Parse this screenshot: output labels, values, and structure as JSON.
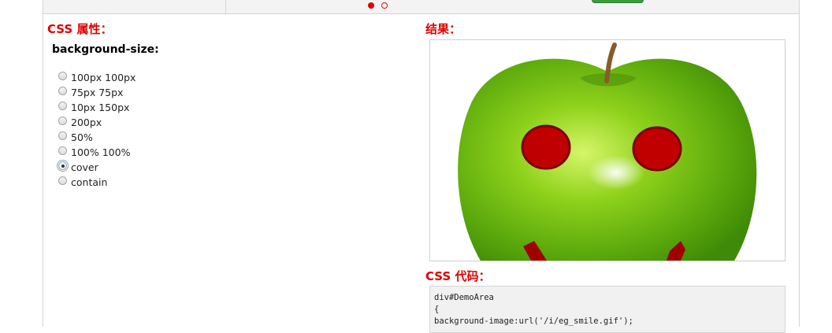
{
  "slider": {
    "dots": [
      "active",
      "inactive"
    ]
  },
  "left": {
    "heading": "CSS 属性：",
    "property_name": "background-size:",
    "options": [
      {
        "label": "100px 100px",
        "checked": false
      },
      {
        "label": "75px 75px",
        "checked": false
      },
      {
        "label": "10px 150px",
        "checked": false
      },
      {
        "label": "200px",
        "checked": false
      },
      {
        "label": "50%",
        "checked": false
      },
      {
        "label": "100% 100%",
        "checked": false
      },
      {
        "label": "cover",
        "checked": true
      },
      {
        "label": "contain",
        "checked": false
      }
    ]
  },
  "right": {
    "result_heading": "结果：",
    "code_heading": "CSS 代码：",
    "code_lines": [
      "div#DemoArea",
      "{",
      "background-image:url('/i/eg_smile.gif');"
    ]
  },
  "colors": {
    "accent": "#e00000",
    "apple_green": "#7cc616",
    "eye_red": "#c00000"
  }
}
